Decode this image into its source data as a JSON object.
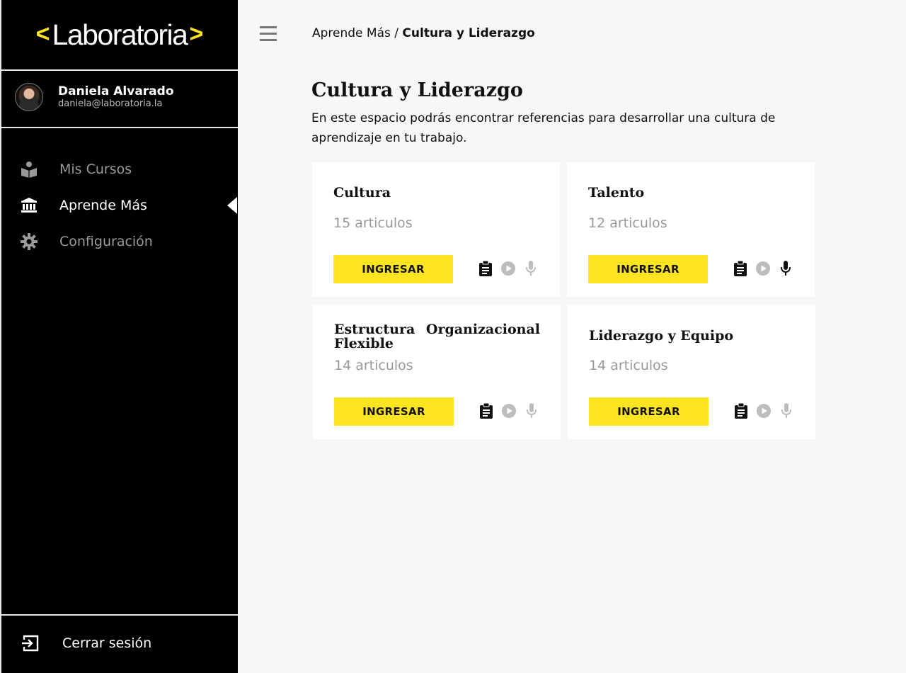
{
  "brand": {
    "logo_left": "<",
    "logo_name": "Laboratoria",
    "logo_right": ">",
    "accent": "#ffe521"
  },
  "user": {
    "name": "Daniela Alvarado",
    "email": "daniela@laboratoria.la"
  },
  "nav": {
    "items": [
      {
        "label": "Mis Cursos",
        "icon": "book-reader-icon",
        "active": false
      },
      {
        "label": "Aprende Más",
        "icon": "institution-icon",
        "active": true
      },
      {
        "label": "Configuración",
        "icon": "gear-icon",
        "active": false
      }
    ],
    "logout": "Cerrar sesión"
  },
  "header": {
    "breadcrumb_parent": "Aprende Más",
    "breadcrumb_sep": " / ",
    "breadcrumb_current": "Cultura y Liderazgo"
  },
  "main": {
    "title": "Cultura y Liderazgo",
    "description": "En este espacio podrás encontrar referencias para desarrollar una cultura de aprendizaje en tu trabajo.",
    "cards": [
      {
        "title": "Cultura",
        "count": "15 articulos",
        "button": "INGRESAR",
        "icons": [
          "document-icon",
          "play-icon",
          "microphone-icon"
        ],
        "active_icons": [
          true,
          false,
          false
        ]
      },
      {
        "title": "Talento",
        "count": "12 articulos",
        "button": "INGRESAR",
        "icons": [
          "document-icon",
          "play-icon",
          "microphone-icon"
        ],
        "active_icons": [
          true,
          false,
          true
        ]
      },
      {
        "title": "Estructura Organizacional Flexible",
        "count": "14 articulos",
        "button": "INGRESAR",
        "icons": [
          "document-icon",
          "play-icon",
          "microphone-icon"
        ],
        "active_icons": [
          true,
          false,
          false
        ]
      },
      {
        "title": "Liderazgo y Equipo",
        "count": "14 articulos",
        "button": "INGRESAR",
        "icons": [
          "document-icon",
          "play-icon",
          "microphone-icon"
        ],
        "active_icons": [
          true,
          false,
          false
        ]
      }
    ]
  },
  "colors": {
    "sidebar_bg": "#000000",
    "page_bg": "#f7f7f7",
    "muted_text": "#999999",
    "icon_inactive": "#bdbdbd",
    "icon_active": "#111111"
  }
}
